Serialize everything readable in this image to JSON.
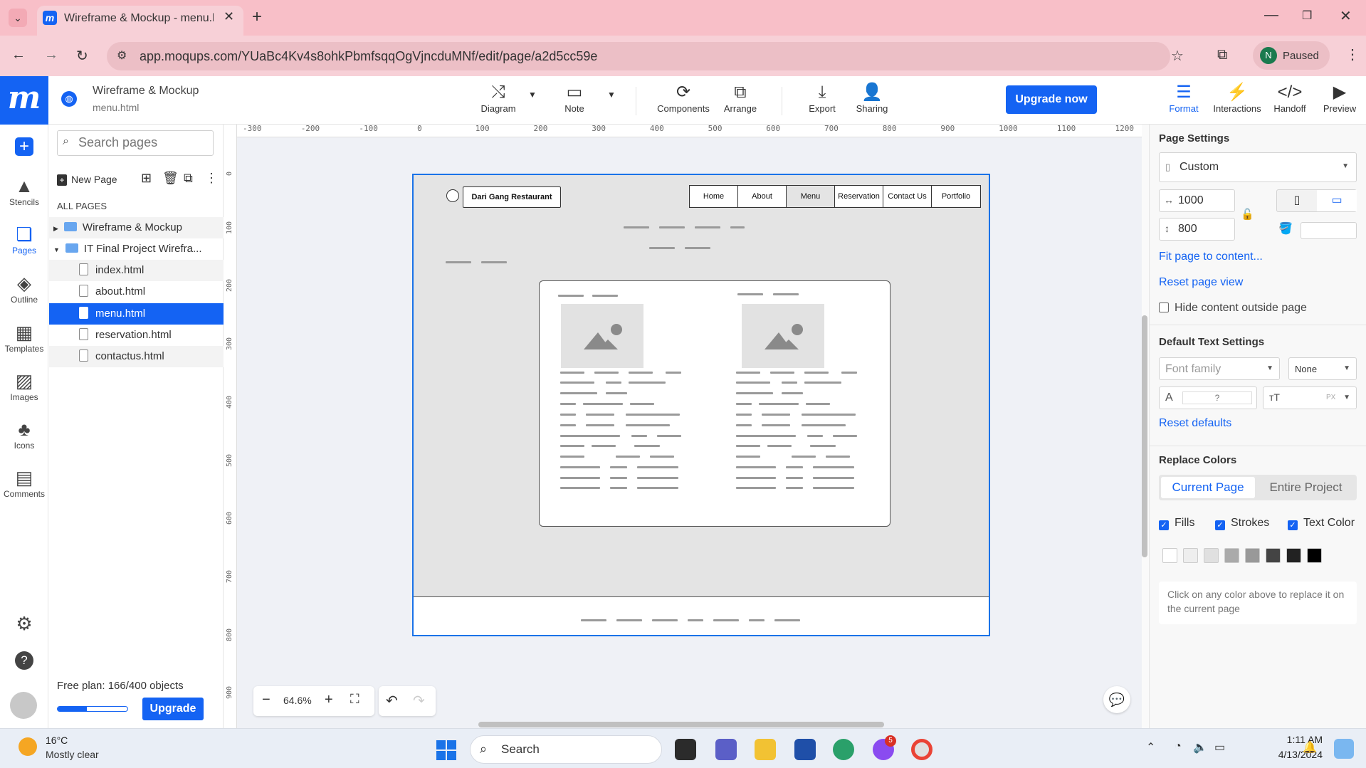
{
  "browser": {
    "tab_title": "Wireframe & Mockup - menu.h",
    "url": "app.moqups.com/YUaBc4Kv4s8ohkPbmfsqqOgVjncduMNf/edit/page/a2d5cc59e",
    "profile_initial": "N",
    "profile_label": "Paused"
  },
  "app": {
    "logo": "m",
    "project_title": "Wireframe & Mockup",
    "page_name": "menu.html",
    "toolbar": {
      "diagram": "Diagram",
      "note": "Note",
      "components": "Components",
      "arrange": "Arrange",
      "export": "Export",
      "sharing": "Sharing",
      "upgrade_now": "Upgrade now",
      "format": "Format",
      "interactions": "Interactions",
      "handoff": "Handoff",
      "preview": "Preview"
    }
  },
  "rail": {
    "stencils": "Stencils",
    "pages": "Pages",
    "outline": "Outline",
    "templates": "Templates",
    "images": "Images",
    "icons": "Icons",
    "comments": "Comments"
  },
  "pages_panel": {
    "search_placeholder": "Search pages",
    "new_page": "New Page",
    "all_pages": "ALL PAGES",
    "tree": [
      {
        "label": "Wireframe & Mockup",
        "type": "folder"
      },
      {
        "label": "IT Final Project Wirefra...",
        "type": "folder"
      },
      {
        "label": "index.html",
        "type": "file"
      },
      {
        "label": "about.html",
        "type": "file"
      },
      {
        "label": "menu.html",
        "type": "file",
        "selected": true
      },
      {
        "label": "reservation.html",
        "type": "file"
      },
      {
        "label": "contactus.html",
        "type": "file"
      }
    ],
    "free_plan": "Free plan: 166/400 objects",
    "usage_fraction": 0.415,
    "upgrade": "Upgrade"
  },
  "canvas": {
    "ruler_h": [
      "-300",
      "-200",
      "-100",
      "0",
      "100",
      "200",
      "300",
      "400",
      "500",
      "600",
      "700",
      "800",
      "900",
      "1000",
      "1100",
      "1200"
    ],
    "ruler_v": [
      "0",
      "100",
      "200",
      "300",
      "400",
      "500",
      "600",
      "700",
      "800",
      "900"
    ],
    "zoom": "64.6%",
    "wireframe": {
      "brand": "Dari Gang Restaurant",
      "nav": [
        "Home",
        "About",
        "Menu",
        "Reservation",
        "Contact Us",
        "Portfolio"
      ],
      "current_nav": "Menu"
    }
  },
  "props": {
    "page_settings": "Page Settings",
    "preset": "Custom",
    "width": "1000",
    "height": "800",
    "fit_page": "Fit page to content...",
    "reset_view": "Reset page view",
    "hide_outside": "Hide content outside page",
    "default_text": "Default Text Settings",
    "font_family": "Font family",
    "font_style": "None",
    "font_size_unknown": "?",
    "px": "PX",
    "reset_defaults": "Reset defaults",
    "replace_colors": "Replace Colors",
    "current_page": "Current Page",
    "entire_project": "Entire Project",
    "fills": "Fills",
    "strokes": "Strokes",
    "text_color": "Text Color",
    "swatches": [
      "#ffffff",
      "#eeeeee",
      "#e0e0e0",
      "#aaaaaa",
      "#999999",
      "#444444",
      "#222222",
      "#000000"
    ],
    "hint": "Click on any color above to replace it on the current page"
  },
  "taskbar": {
    "temp": "16°C",
    "weather": "Mostly clear",
    "search": "Search",
    "time": "1:11 AM",
    "date": "4/13/2024",
    "badge": "5"
  },
  "colors": {
    "accent": "#1463f3",
    "chrome_pink": "#f8bfc8"
  }
}
